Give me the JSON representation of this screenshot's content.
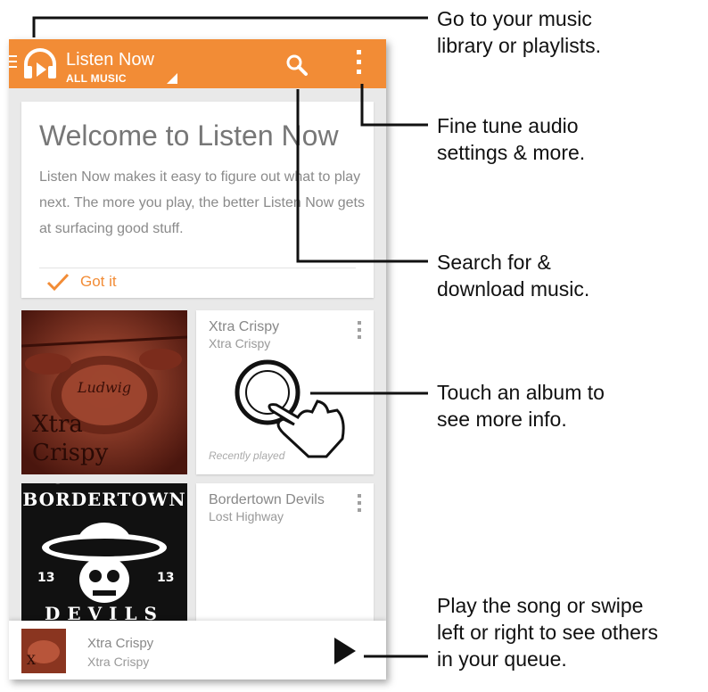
{
  "appbar": {
    "title": "Listen Now",
    "subtitle": "ALL MUSIC",
    "icons": [
      "menu-icon",
      "headphones-icon",
      "dropdown-icon",
      "search-icon",
      "overflow-menu-icon"
    ]
  },
  "welcome_card": {
    "heading": "Welcome to Listen Now",
    "body": "Listen Now makes it easy to figure out what to play next. The more you play, the better Listen Now gets at surfacing good stuff.",
    "action": "Got it",
    "action_icon": "checkmark-icon"
  },
  "albums": [
    {
      "name": "Xtra Crispy",
      "artist": "Xtra Crispy",
      "caption": "Recently played",
      "art_text": "Xtra Crispy",
      "drum_text": "Ludwig"
    },
    {
      "name": "Bordertown Devils",
      "artist": "Lost Highway",
      "art_text_top": "BORDERTOWN",
      "art_text_bottom": "DEVILS",
      "art_number": "13"
    }
  ],
  "now_playing": {
    "song": "Xtra Crispy",
    "artist": "Xtra Crispy",
    "play_icon": "play-icon"
  },
  "callouts": [
    [
      "Go to your music",
      "library or playlists."
    ],
    [
      "Fine tune audio",
      "settings & more."
    ],
    [
      "Search for &",
      "download music."
    ],
    [
      "Touch an album to",
      "see more info."
    ],
    [
      "Play the song or swipe",
      "left or right to see others",
      "in your queue."
    ]
  ],
  "colors": {
    "accent": "#f28c36",
    "background": "#e9e9e9",
    "card": "#ffffff",
    "album1": "#7a2d1e",
    "album2": "#111111"
  }
}
